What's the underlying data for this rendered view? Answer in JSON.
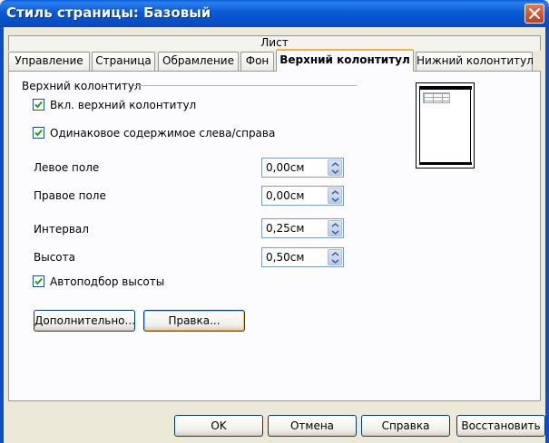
{
  "window": {
    "title": "Стиль страницы: Базовый"
  },
  "group": {
    "label": "Лист"
  },
  "tabs": [
    {
      "label": "Управление"
    },
    {
      "label": "Страница"
    },
    {
      "label": "Обрамление"
    },
    {
      "label": "Фон"
    },
    {
      "label": "Верхний колонтитул",
      "active": true
    },
    {
      "label": "Нижний колонтитул"
    }
  ],
  "section": {
    "title": "Верхний колонтитул"
  },
  "options": {
    "enable_header": {
      "label": "Вкл. верхний колонтитул",
      "checked": true
    },
    "same_content": {
      "label": "Одинаковое содержимое слева/справа",
      "checked": true
    },
    "autofit_height": {
      "label": "Автоподбор высоты",
      "checked": true
    }
  },
  "fields": {
    "left_margin": {
      "label": "Левое поле",
      "value": "0,00см"
    },
    "right_margin": {
      "label": "Правое поле",
      "value": "0,00см"
    },
    "spacing": {
      "label": "Интервал",
      "value": "0,25см"
    },
    "height": {
      "label": "Высота",
      "value": "0,50см"
    }
  },
  "buttons": {
    "more": "Дополнительно...",
    "edit": "Правка...",
    "ok": "OK",
    "cancel": "Отмена",
    "help": "Справка",
    "reset": "Восстановить"
  }
}
